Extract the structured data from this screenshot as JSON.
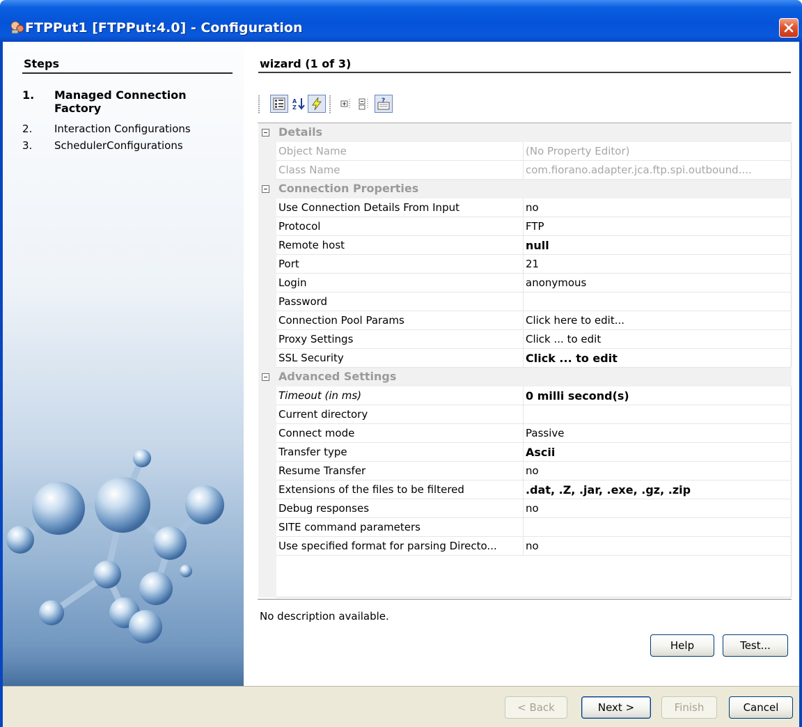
{
  "window": {
    "title": "FTPPut1 [FTPPut:4.0] - Configuration"
  },
  "steps": {
    "heading": "Steps",
    "items": [
      {
        "number": "1.",
        "label": "Managed Connection Factory",
        "active": true
      },
      {
        "number": "2.",
        "label": "Interaction Configurations",
        "active": false
      },
      {
        "number": "3.",
        "label": "SchedulerConfigurations",
        "active": false
      }
    ]
  },
  "wizard": {
    "heading": "wizard (1 of 3)"
  },
  "toolbar": {
    "buttons": [
      {
        "icon": "categorized-icon",
        "pressed": true
      },
      {
        "icon": "sort-alphabetical-icon",
        "pressed": false
      },
      {
        "icon": "lightning-icon",
        "pressed": true
      },
      {
        "icon": "expand-all-icon",
        "pressed": false
      },
      {
        "icon": "collapse-all-icon",
        "pressed": false
      },
      {
        "icon": "help-description-icon",
        "pressed": true
      }
    ]
  },
  "property_sheet": {
    "categories": [
      {
        "label": "Details",
        "properties": [
          {
            "name": "Object Name",
            "value": "(No Property Editor)",
            "disabled": true
          },
          {
            "name": "Class Name",
            "value": "com.fiorano.adapter.jca.ftp.spi.outbound....",
            "disabled": true
          }
        ]
      },
      {
        "label": "Connection Properties",
        "properties": [
          {
            "name": "Use Connection Details From Input",
            "value": "no"
          },
          {
            "name": "Protocol",
            "value": "FTP"
          },
          {
            "name": "Remote host",
            "value": "null",
            "bold": true
          },
          {
            "name": "Port",
            "value": "21"
          },
          {
            "name": "Login",
            "value": "anonymous"
          },
          {
            "name": "Password",
            "value": ""
          },
          {
            "name": "Connection Pool Params",
            "value": "Click here to edit..."
          },
          {
            "name": "Proxy Settings",
            "value": "Click ... to edit"
          },
          {
            "name": "SSL Security",
            "value": "Click ... to edit",
            "bold": true
          }
        ]
      },
      {
        "label": "Advanced Settings",
        "properties": [
          {
            "name": "Timeout (in ms)",
            "value": "0 milli second(s)",
            "bold": true,
            "italic_name": true
          },
          {
            "name": "Current directory",
            "value": ""
          },
          {
            "name": "Connect mode",
            "value": "Passive"
          },
          {
            "name": "Transfer type",
            "value": "Ascii",
            "bold": true
          },
          {
            "name": "Resume Transfer",
            "value": "no"
          },
          {
            "name": "Extensions of the files to be filtered",
            "value": ".dat, .Z, .jar, .exe, .gz, .zip",
            "bold": true
          },
          {
            "name": "Debug responses",
            "value": "no"
          },
          {
            "name": "SITE command parameters",
            "value": ""
          },
          {
            "name": "Use specified format for parsing Directo...",
            "value": "no"
          }
        ]
      }
    ]
  },
  "description": "No description available.",
  "panel_buttons": {
    "help": "Help",
    "test": "Test..."
  },
  "footer_buttons": {
    "back": "< Back",
    "next": "Next >",
    "finish": "Finish",
    "cancel": "Cancel"
  },
  "colors": {
    "titlebar": "#0453d8",
    "close_button": "#e0552f",
    "category_text": "#9a9a9a",
    "footer_bg": "#ece9d8"
  }
}
